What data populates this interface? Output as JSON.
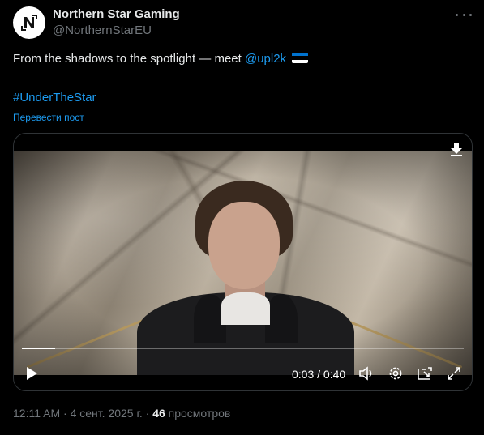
{
  "account": {
    "name": "Northern Star Gaming",
    "handle": "@NorthernStarEU"
  },
  "tweet": {
    "text_before": "From the shadows to the spotlight — meet ",
    "mention": "@upl2k",
    "flag_colors": [
      "#0072ce",
      "#000000",
      "#ffffff"
    ],
    "hashtag": "#UnderTheStar",
    "translate_label": "Перевести пост"
  },
  "video": {
    "current_time": "0:03",
    "duration": "0:40",
    "time_display": "0:03 / 0:40",
    "progress_fraction": 0.075,
    "icons": [
      "download-icon",
      "play-icon",
      "volume-icon",
      "settings-icon",
      "popout-icon",
      "fullscreen-icon"
    ]
  },
  "footer": {
    "time": "12:11 AM",
    "separator": " · ",
    "date": "4 сент. 2025 г.",
    "views_count": "46",
    "views_label": "просмотров"
  },
  "colors": {
    "accent": "#1d9bf0",
    "text": "#e7e9ea",
    "muted": "#71767b",
    "background": "#000000"
  }
}
